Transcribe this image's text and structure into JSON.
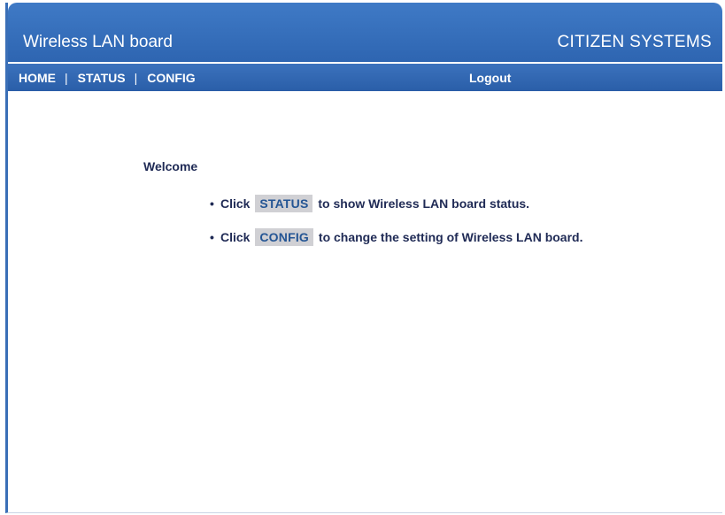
{
  "header": {
    "app_title": "Wireless LAN board",
    "brand": "CITIZEN SYSTEMS"
  },
  "nav": {
    "home": "HOME",
    "status": "STATUS",
    "config": "CONFIG",
    "separator": "|",
    "logout": "Logout"
  },
  "main": {
    "welcome": "Welcome",
    "tips": [
      {
        "bullet": "•",
        "prefix": "Click",
        "button": "STATUS",
        "suffix": "to show Wireless LAN board status."
      },
      {
        "bullet": "•",
        "prefix": "Click",
        "button": "CONFIG",
        "suffix": "to change the setting of Wireless LAN board."
      }
    ]
  },
  "colors": {
    "header_blue": "#2e65b1",
    "nav_blue": "#2a5ea8",
    "text_navy": "#1f2a55",
    "pill_gray": "#d0d0d4",
    "pill_text": "#245594"
  }
}
